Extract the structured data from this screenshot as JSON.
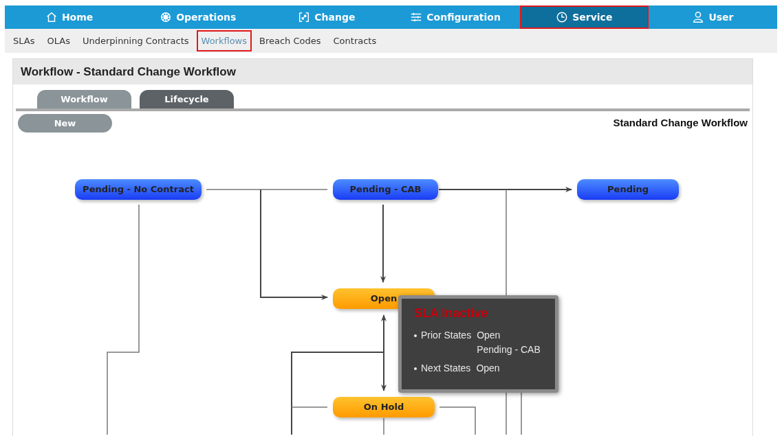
{
  "nav": {
    "items": [
      {
        "label": "Home",
        "selected": false
      },
      {
        "label": "Operations",
        "selected": false
      },
      {
        "label": "Change",
        "selected": false
      },
      {
        "label": "Configuration",
        "selected": false
      },
      {
        "label": "Service",
        "selected": true
      },
      {
        "label": "User",
        "selected": false
      }
    ]
  },
  "subnav": {
    "items": [
      {
        "label": "SLAs",
        "selected": false
      },
      {
        "label": "OLAs",
        "selected": false
      },
      {
        "label": "Underpinning Contracts",
        "selected": false
      },
      {
        "label": "Workflows",
        "selected": true
      },
      {
        "label": "Breach Codes",
        "selected": false
      },
      {
        "label": "Contracts",
        "selected": false
      }
    ]
  },
  "panel": {
    "title": "Workflow - Standard Change Workflow",
    "tabs": [
      {
        "label": "Workflow",
        "selected": true
      },
      {
        "label": "Lifecycle",
        "selected": false
      }
    ],
    "new_button": "New",
    "workflow_name": "Standard Change Workflow"
  },
  "diagram": {
    "states": [
      {
        "label": "Pending - No Contract",
        "kind": "pending"
      },
      {
        "label": "Pending - CAB",
        "kind": "pending"
      },
      {
        "label": "Pending",
        "kind": "pending"
      },
      {
        "label": "Open",
        "kind": "active"
      },
      {
        "label": "On Hold",
        "kind": "active"
      }
    ],
    "tooltip": {
      "title": "SLA Inactive",
      "rows": [
        {
          "label": "Prior States",
          "values": [
            "Open",
            "Pending - CAB"
          ]
        },
        {
          "label": "Next States",
          "values": [
            "Open"
          ]
        }
      ]
    }
  }
}
